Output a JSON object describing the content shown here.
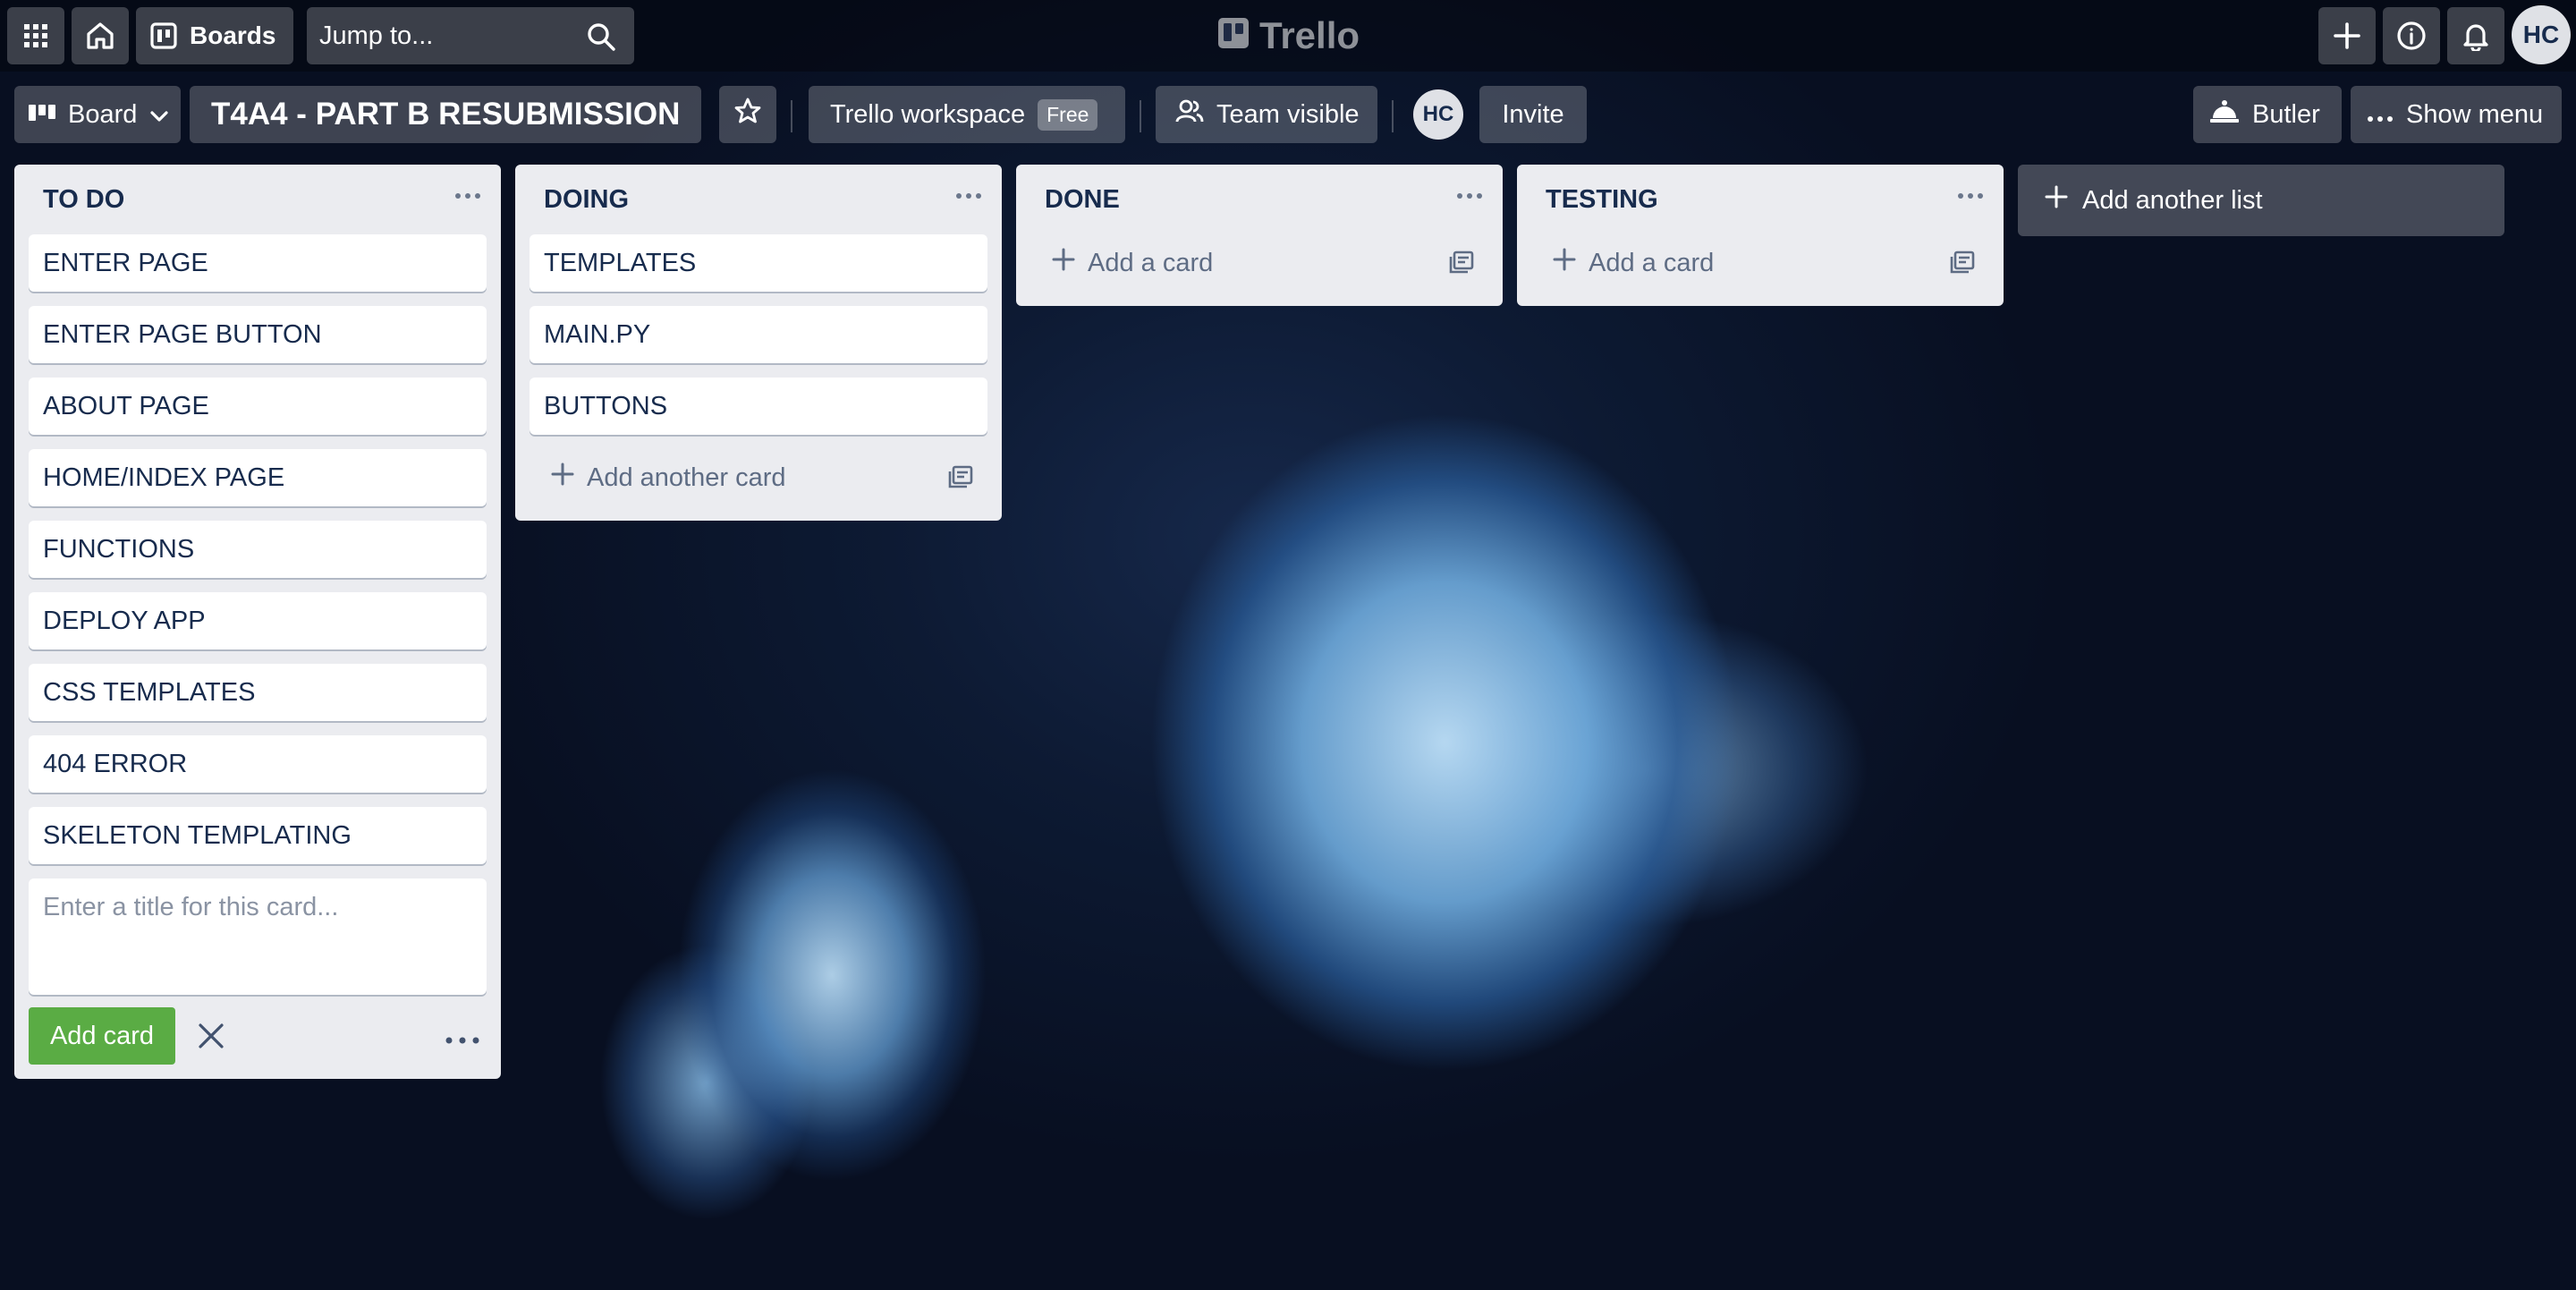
{
  "topbar": {
    "boards_label": "Boards",
    "search_placeholder": "Jump to...",
    "app_name": "Trello",
    "user_initials": "HC"
  },
  "header": {
    "view_label": "Board",
    "board_title": "T4A4 - PART B RESUBMISSION",
    "workspace_label": "Trello workspace",
    "plan_badge": "Free",
    "visibility_label": "Team visible",
    "member_initials": "HC",
    "invite_label": "Invite",
    "butler_label": "Butler",
    "menu_label": "Show menu"
  },
  "lists": [
    {
      "title": "TO DO",
      "cards": [
        "ENTER PAGE",
        "ENTER PAGE BUTTON",
        "ABOUT PAGE",
        "HOME/INDEX PAGE",
        "FUNCTIONS",
        "DEPLOY APP",
        "CSS TEMPLATES",
        "404 ERROR",
        "SKELETON TEMPLATING"
      ],
      "composer_placeholder": "Enter a title for this card...",
      "add_card_button": "Add card"
    },
    {
      "title": "DOING",
      "cards": [
        "TEMPLATES",
        "MAIN.PY",
        "BUTTONS"
      ],
      "add_label": "Add another card"
    },
    {
      "title": "DONE",
      "cards": [],
      "add_label": "Add a card"
    },
    {
      "title": "TESTING",
      "cards": [],
      "add_label": "Add a card"
    }
  ],
  "add_list_label": "Add another list",
  "colors": {
    "list_bg": "#ebecf0",
    "card_text": "#172b4d",
    "add_card_green": "#5aac44"
  }
}
